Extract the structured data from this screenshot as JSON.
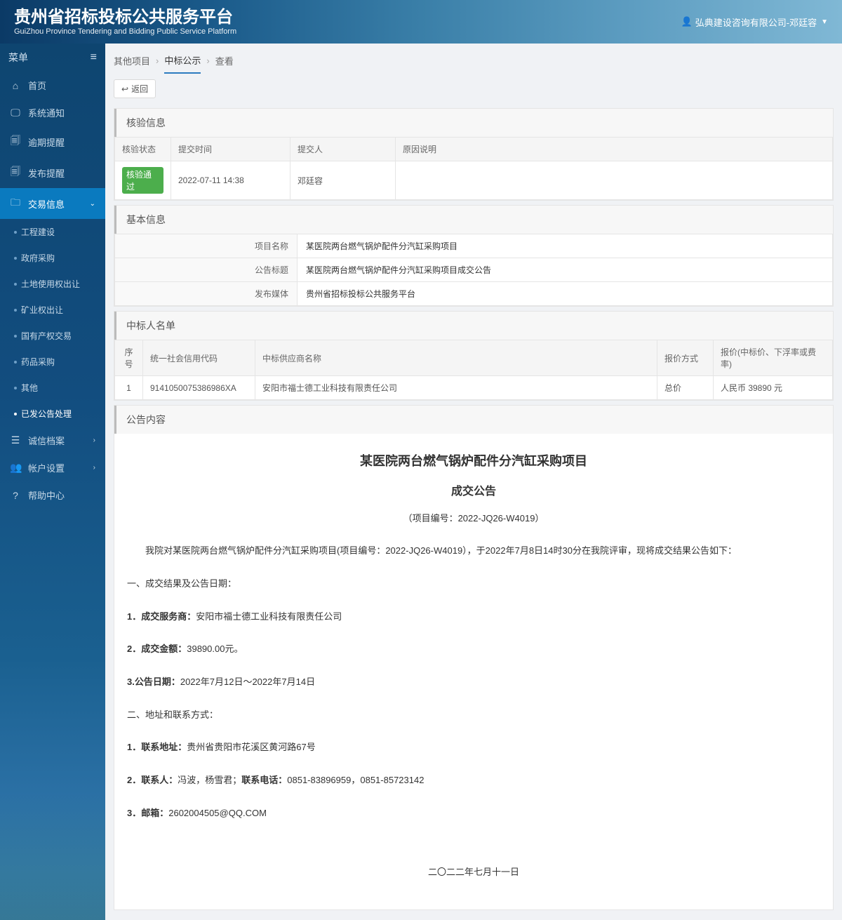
{
  "header": {
    "title": "贵州省招标投标公共服务平台",
    "subtitle": "GuiZhou Province Tendering and Bidding Public Service Platform",
    "user_prefix": "弘典建设咨询有限公司-邓廷容"
  },
  "sidebar": {
    "menu_label": "菜单",
    "items": {
      "home": "首页",
      "sysnotice": "系统通知",
      "overdue": "逾期提醒",
      "publish": "发布提醒",
      "trade": "交易信息",
      "credit": "诚信档案",
      "account": "帐户设置",
      "help": "帮助中心"
    },
    "sub_items": {
      "gcjs": "工程建设",
      "zfcg": "政府采购",
      "tdsyq": "土地使用权出让",
      "kyqcr": "矿业权出让",
      "gycqjy": "国有产权交易",
      "ypcg": "药品采购",
      "qt": "其他",
      "yfgg": "已发公告处理"
    }
  },
  "breadcrumb": {
    "a": "其他项目",
    "b": "中标公示",
    "c": "查看"
  },
  "back_label": "返回",
  "panels": {
    "verify_title": "核验信息",
    "basic_title": "基本信息",
    "winner_title": "中标人名单",
    "notice_title": "公告内容"
  },
  "verify": {
    "headers": {
      "status": "核验状态",
      "time": "提交时间",
      "person": "提交人",
      "reason": "原因说明"
    },
    "row": {
      "status": "核验通过",
      "time": "2022-07-11 14:38",
      "person": "邓廷容",
      "reason": ""
    }
  },
  "basic": {
    "labels": {
      "project_name": "项目名称",
      "notice_title": "公告标题",
      "media": "发布媒体"
    },
    "values": {
      "project_name": "某医院两台燃气锅炉配件分汽缸采购项目",
      "notice_title": "某医院两台燃气锅炉配件分汽缸采购项目成交公告",
      "media": "贵州省招标投标公共服务平台"
    }
  },
  "winner": {
    "headers": {
      "no": "序号",
      "uscc": "统一社会信用代码",
      "name": "中标供应商名称",
      "method": "报价方式",
      "price": "报价(中标价、下浮率或费率)"
    },
    "row": {
      "no": "1",
      "uscc": "9141050075386986XA",
      "name": "安阳市福士德工业科技有限责任公司",
      "method": "总价",
      "price": "人民币 39890 元"
    }
  },
  "notice": {
    "title": "某医院两台燃气锅炉配件分汽缸采购项目",
    "sub": "成交公告",
    "code": "（项目编号：2022-JQ26-W4019）",
    "intro": "我院对某医院两台燃气锅炉配件分汽缸采购项目(项目编号：2022-JQ26-W4019），于2022年7月8日14时30分在我院评审，现将成交结果公告如下：",
    "s1_title": "一、成交结果及公告日期：",
    "s1_l1_label": "1．成交服务商：",
    "s1_l1_value": "安阳市福士德工业科技有限责任公司",
    "s1_l2_label": "2．成交金额：",
    "s1_l2_value": "39890.00元。",
    "s1_l3_label": "3.公告日期：",
    "s1_l3_value": "2022年7月12日～2022年7月14日",
    "s2_title": "二、地址和联系方式：",
    "s2_l1_label": "1．联系地址：",
    "s2_l1_value": "贵州省贵阳市花溪区黄河路67号",
    "s2_l2_label": "2．联系人：",
    "s2_l2_value": "冯波，杨雪君；",
    "s2_l2_label2": "联系电话：",
    "s2_l2_value2": "0851-83896959，0851-85723142",
    "s2_l3_label": "3．邮箱：",
    "s2_l3_value": "2602004505@QQ.COM",
    "date": "二〇二二年七月十一日"
  }
}
